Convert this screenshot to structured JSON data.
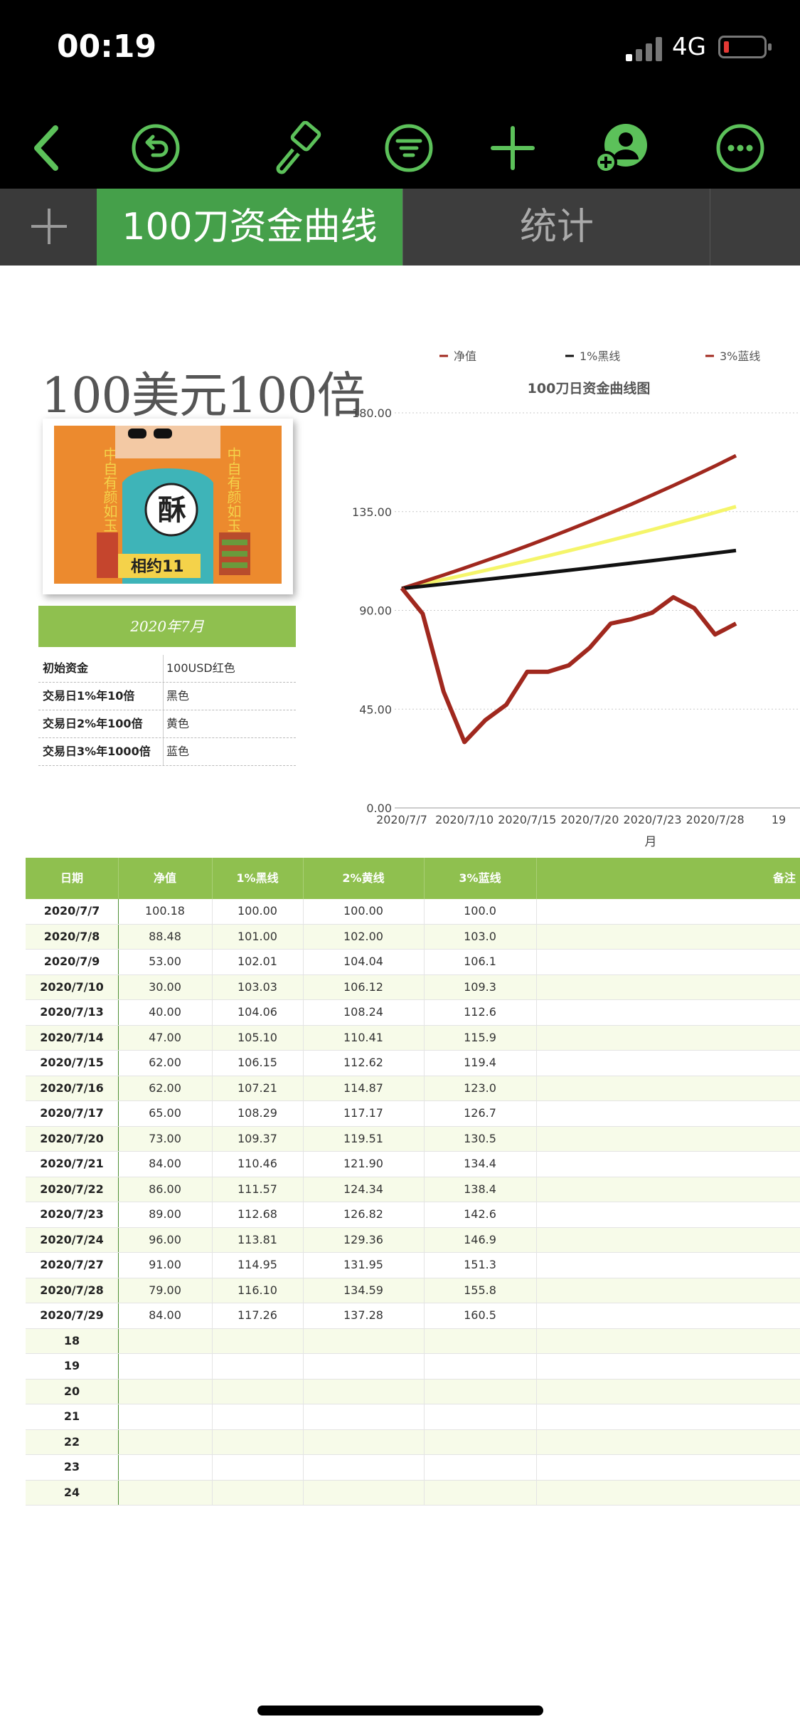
{
  "status_bar": {
    "time": "00:19",
    "network": "4G"
  },
  "toolbar": {
    "icons": [
      "back-chevron-icon",
      "undo-icon",
      "paintbrush-icon",
      "filter-icon",
      "add-icon",
      "collaborate-icon",
      "more-icon"
    ],
    "accent_color": "#5cc15a"
  },
  "tabs": [
    {
      "label": "100刀资金曲线",
      "active": true
    },
    {
      "label": "统计",
      "active": false
    }
  ],
  "info": {
    "title": "100美元100倍",
    "month": "2020年7月",
    "rows": [
      {
        "key": "初始资金",
        "value": "100USD红色"
      },
      {
        "key": "交易日1%年10倍",
        "value": "黑色"
      },
      {
        "key": "交易日2%年100倍",
        "value": "黄色"
      },
      {
        "key": "交易日3%年1000倍",
        "value": "蓝色"
      }
    ],
    "photo_text": [
      "中自有颜如玉",
      "中自有颜如玉",
      "酥",
      "相约11"
    ]
  },
  "chart_data": {
    "type": "line",
    "title": "100刀日资金曲线图",
    "xlabel": "月",
    "ylabel": "",
    "ylim": [
      0,
      180
    ],
    "yticks": [
      "180.00",
      "135.00",
      "90.00",
      "45.00",
      "0.00"
    ],
    "xticks": [
      "2020/7/7",
      "2020/7/10",
      "2020/7/15",
      "2020/7/20",
      "2020/7/23",
      "2020/7/28",
      "19"
    ],
    "legend": [
      "净值",
      "1%黑线",
      "3%蓝线"
    ],
    "legend_position": "top",
    "categories": [
      "2020/7/7",
      "2020/7/8",
      "2020/7/9",
      "2020/7/10",
      "2020/7/13",
      "2020/7/14",
      "2020/7/15",
      "2020/7/16",
      "2020/7/17",
      "2020/7/20",
      "2020/7/21",
      "2020/7/22",
      "2020/7/23",
      "2020/7/24",
      "2020/7/27",
      "2020/7/28",
      "2020/7/29"
    ],
    "series": [
      {
        "name": "净值",
        "color": "#a0281e",
        "values": [
          100.18,
          88.48,
          53.0,
          30.0,
          40.0,
          47.0,
          62.0,
          62.0,
          65.0,
          73.0,
          84.0,
          86.0,
          89.0,
          96.0,
          91.0,
          79.0,
          84.0
        ]
      },
      {
        "name": "1%黑线",
        "color": "#111111",
        "values": [
          100.0,
          101.0,
          102.01,
          103.03,
          104.06,
          105.1,
          106.15,
          107.21,
          108.29,
          109.37,
          110.46,
          111.57,
          112.68,
          113.81,
          114.95,
          116.1,
          117.26
        ]
      },
      {
        "color": "#f5f56a",
        "values": [
          100.0,
          102.0,
          104.04,
          106.12,
          108.24,
          110.41,
          112.62,
          114.87,
          117.17,
          119.51,
          121.9,
          124.34,
          126.82,
          129.36,
          131.95,
          134.59,
          137.28
        ]
      },
      {
        "name": "3%蓝线",
        "color": "#a0281e",
        "values": [
          100.0,
          103.0,
          106.1,
          109.3,
          112.6,
          115.9,
          119.4,
          123.0,
          126.7,
          130.5,
          134.4,
          138.4,
          142.6,
          146.9,
          151.3,
          155.8,
          160.5
        ]
      }
    ]
  },
  "table": {
    "headers": [
      "日期",
      "净值",
      "1%黑线",
      "2%黄线",
      "3%蓝线",
      "备注"
    ],
    "rows": [
      [
        "2020/7/7",
        "100.18",
        "100.00",
        "100.00",
        "100.0"
      ],
      [
        "2020/7/8",
        "88.48",
        "101.00",
        "102.00",
        "103.0"
      ],
      [
        "2020/7/9",
        "53.00",
        "102.01",
        "104.04",
        "106.1"
      ],
      [
        "2020/7/10",
        "30.00",
        "103.03",
        "106.12",
        "109.3"
      ],
      [
        "2020/7/13",
        "40.00",
        "104.06",
        "108.24",
        "112.6"
      ],
      [
        "2020/7/14",
        "47.00",
        "105.10",
        "110.41",
        "115.9"
      ],
      [
        "2020/7/15",
        "62.00",
        "106.15",
        "112.62",
        "119.4"
      ],
      [
        "2020/7/16",
        "62.00",
        "107.21",
        "114.87",
        "123.0"
      ],
      [
        "2020/7/17",
        "65.00",
        "108.29",
        "117.17",
        "126.7"
      ],
      [
        "2020/7/20",
        "73.00",
        "109.37",
        "119.51",
        "130.5"
      ],
      [
        "2020/7/21",
        "84.00",
        "110.46",
        "121.90",
        "134.4"
      ],
      [
        "2020/7/22",
        "86.00",
        "111.57",
        "124.34",
        "138.4"
      ],
      [
        "2020/7/23",
        "89.00",
        "112.68",
        "126.82",
        "142.6"
      ],
      [
        "2020/7/24",
        "96.00",
        "113.81",
        "129.36",
        "146.9"
      ],
      [
        "2020/7/27",
        "91.00",
        "114.95",
        "131.95",
        "151.3"
      ],
      [
        "2020/7/28",
        "79.00",
        "116.10",
        "134.59",
        "155.8"
      ],
      [
        "2020/7/29",
        "84.00",
        "117.26",
        "137.28",
        "160.5"
      ],
      [
        "18",
        "",
        "",
        "",
        ""
      ],
      [
        "19",
        "",
        "",
        "",
        ""
      ],
      [
        "20",
        "",
        "",
        "",
        ""
      ],
      [
        "21",
        "",
        "",
        "",
        ""
      ],
      [
        "22",
        "",
        "",
        "",
        ""
      ],
      [
        "23",
        "",
        "",
        "",
        ""
      ],
      [
        "24",
        "",
        "",
        "",
        ""
      ]
    ]
  }
}
